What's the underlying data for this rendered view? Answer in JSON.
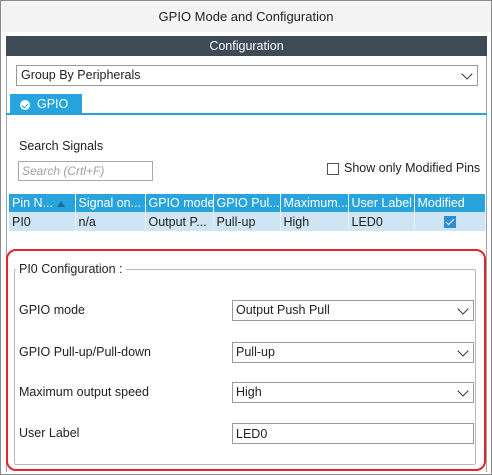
{
  "window": {
    "title": "GPIO Mode and Configuration"
  },
  "configuration": {
    "header": "Configuration",
    "group_by": {
      "selected": "Group By Peripherals"
    }
  },
  "tabs": [
    {
      "label": "GPIO",
      "active": true
    }
  ],
  "search": {
    "title": "Search Signals",
    "placeholder": "Search (Crtl+F)",
    "show_modified_label": "Show only Modified Pins",
    "show_modified_checked": false
  },
  "table": {
    "columns": [
      "Pin N...",
      "Signal on...",
      "GPIO mode",
      "GPIO Pul...",
      "Maximum...",
      "User Label",
      "Modified"
    ],
    "rows": [
      {
        "pin": "PI0",
        "signal": "n/a",
        "gpio_mode": "Output P...",
        "pull": "Pull-up",
        "max_speed": "High",
        "user_label": "LED0",
        "modified": true
      }
    ]
  },
  "pin_config": {
    "legend": "PI0 Configuration :",
    "gpio_mode": {
      "label": "GPIO mode",
      "value": "Output Push Pull"
    },
    "pull": {
      "label": "GPIO Pull-up/Pull-down",
      "value": "Pull-up"
    },
    "speed": {
      "label": "Maximum output speed",
      "value": "High"
    },
    "user_label": {
      "label": "User Label",
      "value": "LED0"
    }
  },
  "colors": {
    "header_bg": "#3f4a57",
    "accent_blue": "#26a4dd",
    "selected_row": "#cfe5f3",
    "highlight_border": "#e0262b"
  },
  "icons": [
    "check-circle-icon",
    "chevron-down-icon",
    "sort-up-icon",
    "checkbox-checked-icon"
  ]
}
